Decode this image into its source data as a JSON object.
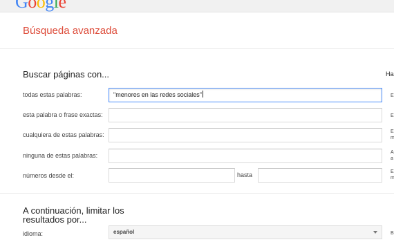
{
  "header": {
    "logo_letters": [
      {
        "ch": "G",
        "color": "#4285f4"
      },
      {
        "ch": "o",
        "color": "#ea4335"
      },
      {
        "ch": "o",
        "color": "#fbbc05"
      },
      {
        "ch": "g",
        "color": "#4285f4"
      },
      {
        "ch": "l",
        "color": "#34a853"
      },
      {
        "ch": "e",
        "color": "#ea4335"
      }
    ]
  },
  "page_title": "Búsqueda avanzada",
  "search_section": {
    "heading": "Buscar páginas con...",
    "right_tip": "Haz",
    "rows": [
      {
        "label": "todas estas palabras:",
        "value": "\"menores en las redes sociales\"",
        "hint": "E"
      },
      {
        "label": "esta palabra o frase exactas:",
        "value": "",
        "hint": "E"
      },
      {
        "label": "cualquiera de estas palabras:",
        "value": "",
        "hint": "E\nm"
      },
      {
        "label": "ninguna de estas palabras:",
        "value": "",
        "hint": "A\na"
      }
    ],
    "numbers_row": {
      "label": "números desde el:",
      "from_value": "",
      "to_label": "hasta",
      "to_value": "",
      "hint": "E\nm"
    }
  },
  "limit_section": {
    "heading": "A continuación, limitar los resultados por...",
    "language": {
      "label": "idioma:",
      "selected": "español",
      "hint": "B"
    }
  },
  "colors": {
    "accent_title": "#dd4b39",
    "focus_border": "#4d90fe"
  }
}
